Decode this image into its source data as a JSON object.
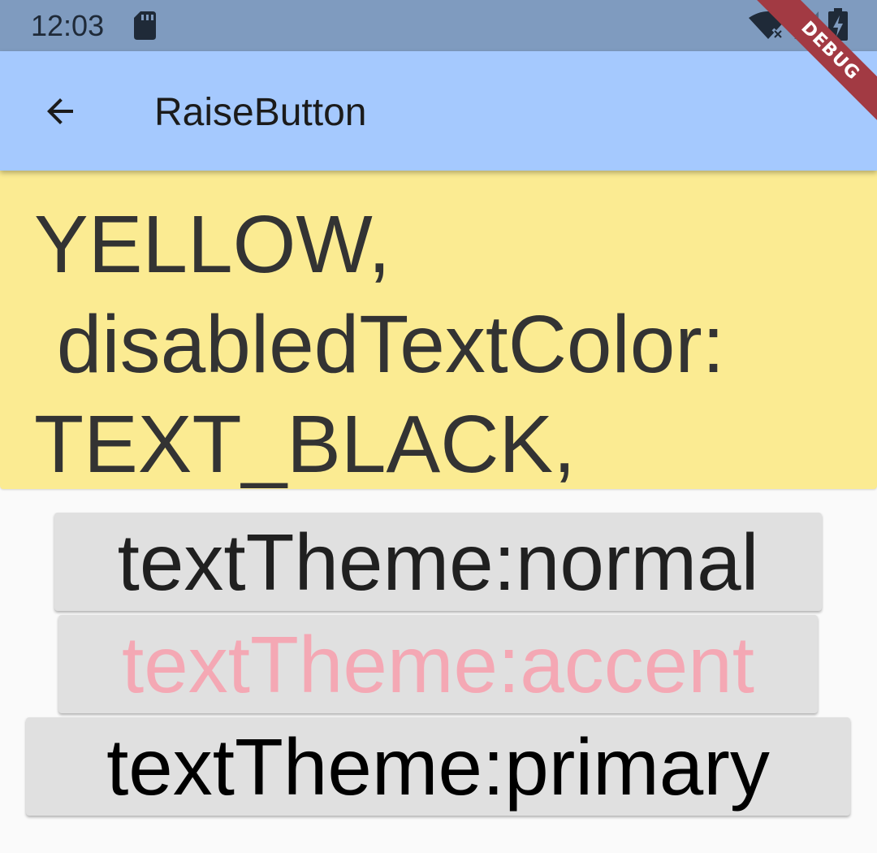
{
  "status_bar": {
    "time": "12:03",
    "icons": [
      "sd-card-icon",
      "wifi-icon",
      "signal-icon",
      "battery-icon"
    ]
  },
  "app_bar": {
    "title": "RaiseButton",
    "back_icon": "arrow-back-icon"
  },
  "debug_banner": "DEBUG",
  "panel": {
    "text": "YELLOW,\n disabledTextColor:\nTEXT_BLACK,"
  },
  "buttons": [
    {
      "label": "textTheme:normal",
      "text_color": "#202020"
    },
    {
      "label": "textTheme:accent",
      "text_color": "#f4a8b4"
    },
    {
      "label": "textTheme:primary",
      "text_color": "#000000"
    }
  ],
  "colors": {
    "status_bar": "#7f9bbf",
    "app_bar": "#a5c9fe",
    "panel": "#fbeb92",
    "button_bg": "#e0e0e0",
    "background": "#fafafa",
    "debug_ribbon": "#a23a43"
  }
}
